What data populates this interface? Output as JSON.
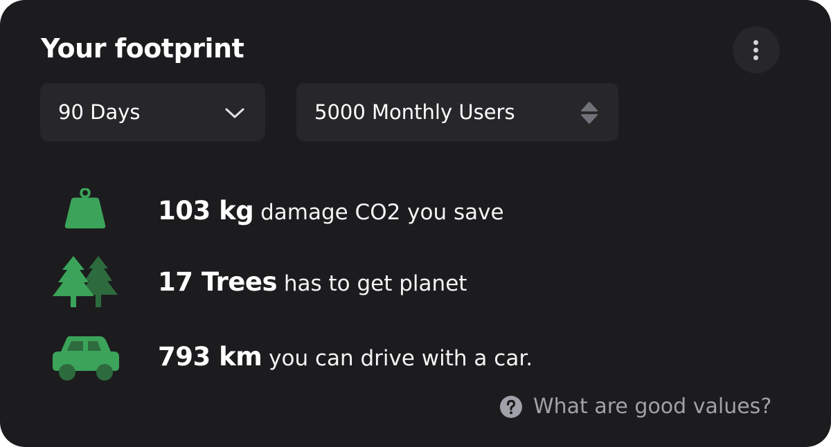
{
  "card": {
    "title": "Your footprint"
  },
  "menu": {
    "icon": "more-vertical-icon"
  },
  "filters": {
    "period": {
      "value": "90 Days",
      "icon": "chevron-down-icon"
    },
    "users": {
      "value": "5000 Monthly Users",
      "icon": "sort-updown-icon"
    }
  },
  "stats": [
    {
      "icon": "weight-icon",
      "value": "103 kg",
      "description": "damage CO2 you save"
    },
    {
      "icon": "trees-icon",
      "value": "17 Trees",
      "description": "has to get planet"
    },
    {
      "icon": "car-icon",
      "value": "793 km",
      "description": "you can drive with a car."
    }
  ],
  "help": {
    "icon": "question-circle-icon",
    "label": "What are good values?"
  },
  "colors": {
    "background": "#1c1c1e",
    "control": "#27272a",
    "accent_green": "#3ba45a",
    "accent_green_dark": "#2d6b3e",
    "muted_text": "#a1a1aa"
  }
}
